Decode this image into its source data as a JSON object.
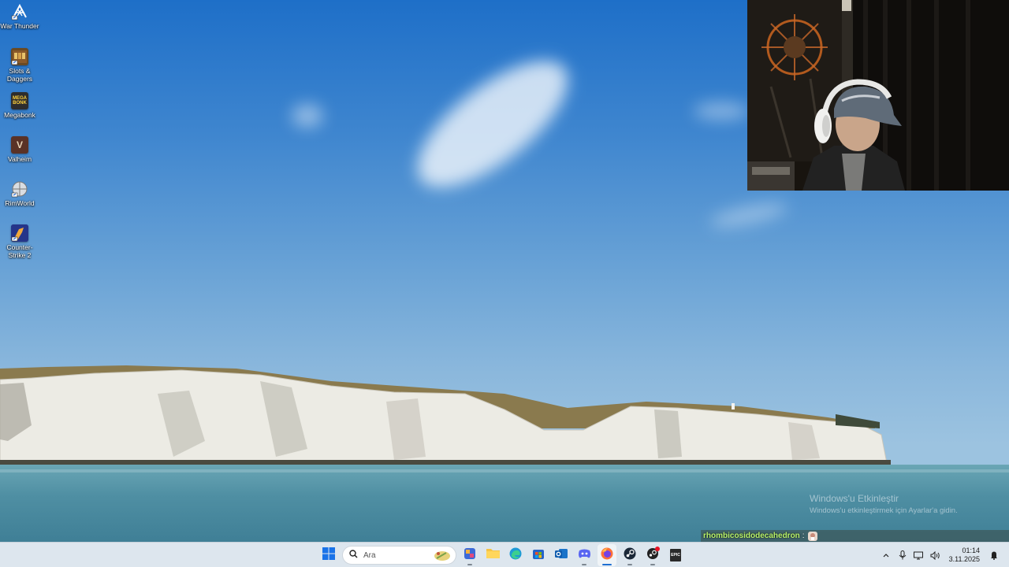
{
  "desktop": {
    "icons": [
      {
        "label": "War Thunder",
        "icon": "war-thunder-icon"
      },
      {
        "label": "Slots & Daggers",
        "icon": "slots-daggers-icon"
      },
      {
        "label": "Megabonk",
        "icon": "megabonk-icon",
        "glyph_text": "MEGA BONK"
      },
      {
        "label": "Valheim",
        "icon": "valheim-icon",
        "glyph_text": "V"
      },
      {
        "label": "RimWorld",
        "icon": "rimworld-icon"
      },
      {
        "label": "Counter-Strike 2",
        "icon": "counter-strike-2-icon"
      }
    ]
  },
  "watermark": {
    "title": "Windows'u Etkinleştir",
    "subtitle": "Windows'u etkinleştirmek için Ayarlar'a gidin."
  },
  "chat": {
    "username": "rhombicosidodecahedron",
    "separator": ":",
    "emote": "emote-icon"
  },
  "taskbar": {
    "search_placeholder": "Ara",
    "apps": [
      {
        "name": "start-button",
        "icon": "windows-logo-icon"
      },
      {
        "name": "widgets",
        "icon": "copilot-icon"
      },
      {
        "name": "file-explorer",
        "icon": "folder-icon"
      },
      {
        "name": "edge",
        "icon": "edge-icon"
      },
      {
        "name": "microsoft-store",
        "icon": "store-icon"
      },
      {
        "name": "outlook",
        "icon": "outlook-icon"
      },
      {
        "name": "discord",
        "icon": "discord-icon"
      },
      {
        "name": "firefox",
        "icon": "firefox-icon"
      },
      {
        "name": "steam",
        "icon": "steam-icon"
      },
      {
        "name": "steam-alt",
        "icon": "steam-notification-icon"
      },
      {
        "name": "epic-games",
        "icon": "epic-games-icon",
        "glyph_text": "EPIC"
      }
    ],
    "tray": {
      "icons": [
        "chevron-up-icon",
        "microphone-icon",
        "network-icon",
        "volume-icon"
      ],
      "time": "01:14",
      "date": "3.11.2025"
    }
  },
  "colors": {
    "taskbar_bg": "#dde6ee",
    "accent": "#1f6fd1",
    "chat_username": "#b8f26a"
  }
}
